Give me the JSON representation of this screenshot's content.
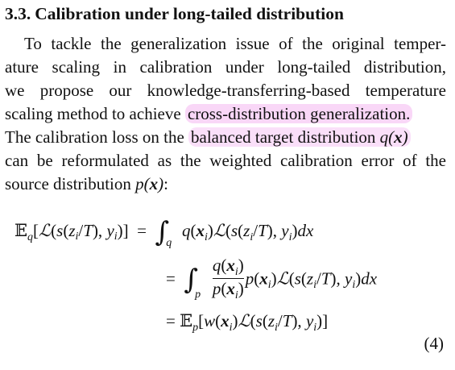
{
  "section": {
    "number": "3.3.",
    "title": "Calibration under long-tailed distribution"
  },
  "paragraph": {
    "lines": [
      "To tackle the generalization issue of the original temper-",
      "ature scaling in calibration under long-tailed distribution,",
      "we propose our knowledge-transferring-based temperature",
      "scaling method to achieve",
      "The calibration loss on the"
    ],
    "highlight_1": "cross-distribution generalization.",
    "highlight_2_text": "balanced target distribution",
    "line6": "can be reformulated as the weighted calibration error of the",
    "line7": "source distribution"
  },
  "equation": {
    "number": "(4)",
    "highlight_color": "#f096eb"
  }
}
